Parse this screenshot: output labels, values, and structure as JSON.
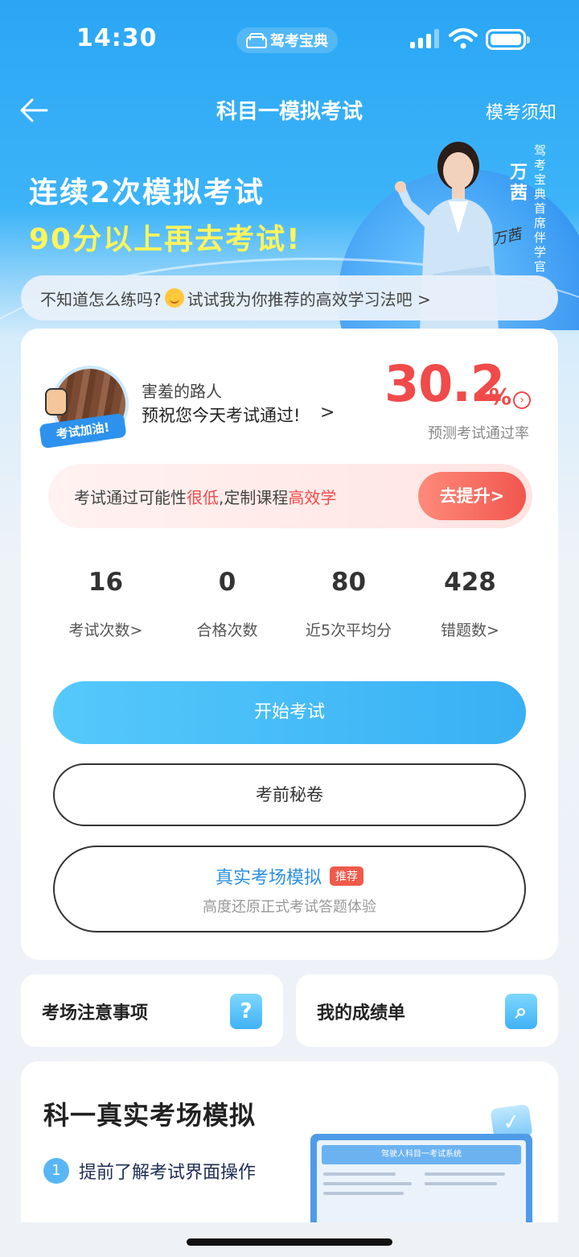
{
  "status_bar": {
    "time": "14:30",
    "app_badge": "驾考宝典",
    "icons": [
      "car-icon",
      "signal-icon",
      "wifi-icon",
      "battery-icon"
    ]
  },
  "nav": {
    "title": "科目一模拟考试",
    "right_label": "模考须知",
    "back_icon": "back-arrow-icon"
  },
  "banner": {
    "line1": "连续2次模拟考试",
    "line2": "90分以上再去考试!",
    "host_name": "万茜",
    "host_title": "驾考宝典首席伴学官",
    "signature": "万茜"
  },
  "tip": {
    "text_before": "不知道怎么练吗?",
    "text_after": "试试我为你推荐的高效学习法吧 >"
  },
  "profile": {
    "avatar_tag": "考试加油!",
    "username": "害羞的路人",
    "wish": "预祝您今天考试通过!",
    "wish_arrow": ">",
    "pass_rate": "30.2",
    "pass_rate_unit": "%",
    "pass_rate_label": "预测考试通过率"
  },
  "promo": {
    "text1": "考试通过可能性",
    "highlight1": "很低",
    "text2": ",定制课程",
    "highlight2": "高效学",
    "button": "去提升>"
  },
  "stats": [
    {
      "value": "16",
      "label": "考试次数>"
    },
    {
      "value": "0",
      "label": "合格次数"
    },
    {
      "value": "80",
      "label": "近5次平均分"
    },
    {
      "value": "428",
      "label": "错题数>"
    }
  ],
  "buttons": {
    "start": "开始考试",
    "secret": "考前秘卷",
    "sim_title": "真实考场模拟",
    "sim_tag": "推荐",
    "sim_sub": "高度还原正式考试答题体验"
  },
  "quick": {
    "left": "考场注意事项",
    "left_icon": "question-icon",
    "right": "我的成绩单",
    "right_icon": "search-icon"
  },
  "section": {
    "title": "科一真实考场模拟",
    "step1_num": "1",
    "step1": "提前了解考试界面操作",
    "preview_title": "驾驶人科目一考试系统"
  },
  "colors": {
    "accent_blue": "#39b0f4",
    "warning_red": "#f04a4a",
    "slogan_yellow": "#fff45c"
  }
}
